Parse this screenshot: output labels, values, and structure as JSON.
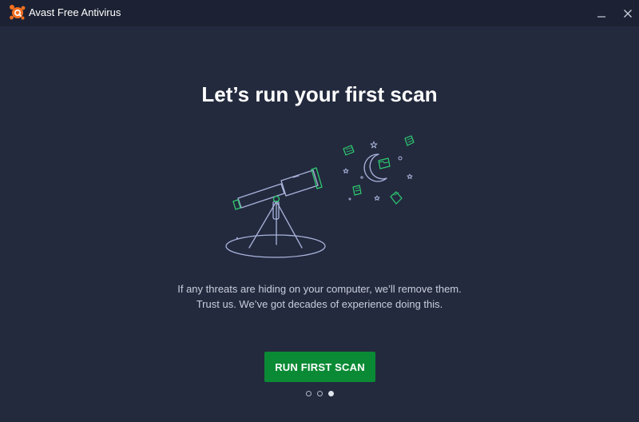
{
  "window": {
    "title": "Avast Free Antivirus",
    "minimize_icon": "minimize-icon",
    "close_icon": "close-icon",
    "logo_icon": "avast-logo-icon"
  },
  "main": {
    "headline": "Let’s run your first scan",
    "description_line1": "If any threats are hiding on your computer, we’ll remove them.",
    "description_line2": "Trust us. We’ve got decades of experience doing this.",
    "cta_label": "RUN FIRST SCAN",
    "illustration": "telescope-night-sky-illustration"
  },
  "pagination": {
    "total": 3,
    "active_index": 2
  },
  "colors": {
    "background": "#232a3e",
    "titlebar": "#1c2233",
    "accent_green": "#0b8a35",
    "logo_orange": "#f36f21",
    "illustration_line": "#aab4dc",
    "illustration_green": "#2ecc71"
  }
}
